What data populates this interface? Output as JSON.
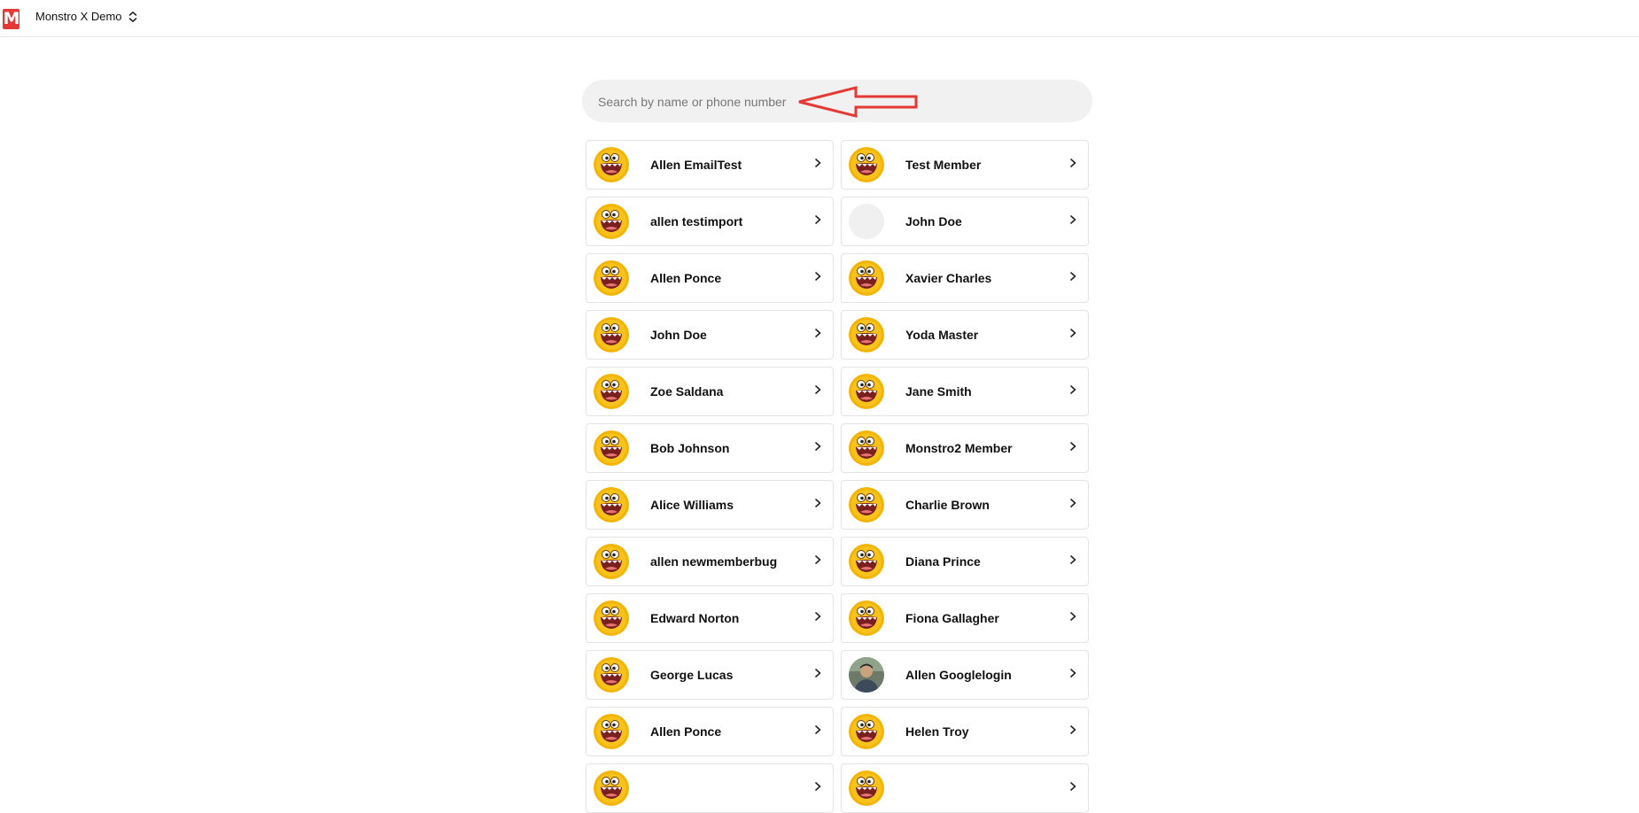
{
  "header": {
    "logo_text": "M",
    "workspace_name": "Monstro X Demo",
    "workspace_icon": "chevron-up-down-icon"
  },
  "search": {
    "placeholder": "Search by name or phone number",
    "value": ""
  },
  "colors": {
    "brand": "#e53935",
    "avatar_yellow": "#f5b400",
    "annotation_arrow": "#e53935"
  },
  "members": [
    {
      "name": "Allen EmailTest",
      "avatar": "monster"
    },
    {
      "name": "Test Member",
      "avatar": "monster"
    },
    {
      "name": "allen testimport",
      "avatar": "monster"
    },
    {
      "name": "John Doe",
      "avatar": "blank"
    },
    {
      "name": "Allen Ponce",
      "avatar": "monster"
    },
    {
      "name": "Xavier Charles",
      "avatar": "monster"
    },
    {
      "name": "John Doe",
      "avatar": "monster"
    },
    {
      "name": "Yoda Master",
      "avatar": "monster"
    },
    {
      "name": "Zoe Saldana",
      "avatar": "monster"
    },
    {
      "name": "Jane Smith",
      "avatar": "monster"
    },
    {
      "name": "Bob Johnson",
      "avatar": "monster"
    },
    {
      "name": "Monstro2 Member",
      "avatar": "monster"
    },
    {
      "name": "Alice Williams",
      "avatar": "monster"
    },
    {
      "name": "Charlie Brown",
      "avatar": "monster"
    },
    {
      "name": "allen newmemberbug",
      "avatar": "monster"
    },
    {
      "name": "Diana Prince",
      "avatar": "monster"
    },
    {
      "name": "Edward Norton",
      "avatar": "monster"
    },
    {
      "name": "Fiona Gallagher",
      "avatar": "monster"
    },
    {
      "name": "George Lucas",
      "avatar": "monster"
    },
    {
      "name": "Allen Googlelogin",
      "avatar": "photo"
    },
    {
      "name": "Allen Ponce",
      "avatar": "monster"
    },
    {
      "name": "Helen Troy",
      "avatar": "monster"
    },
    {
      "name": "",
      "avatar": "monster"
    },
    {
      "name": "",
      "avatar": "monster"
    }
  ]
}
